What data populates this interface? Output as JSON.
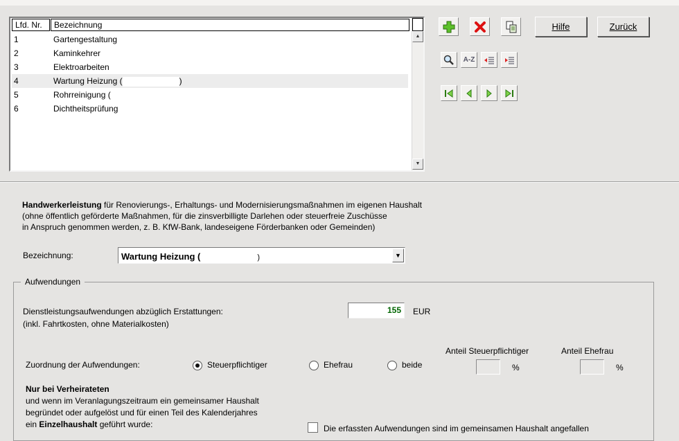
{
  "list": {
    "col_nr": "Lfd. Nr.",
    "col_bez": "Bezeichnung",
    "rows": [
      {
        "nr": "1",
        "bez": "Gartengestaltung"
      },
      {
        "nr": "2",
        "bez": "Kaminkehrer"
      },
      {
        "nr": "3",
        "bez": "Elektroarbeiten"
      },
      {
        "nr": "4",
        "bez": "Wartung Heizung ("
      },
      {
        "nr": "5",
        "bez": "Rohrreinigung ("
      },
      {
        "nr": "6",
        "bez": "Dichtheitsprüfung"
      }
    ],
    "row4_suffix": ")"
  },
  "toolbar": {
    "help_label": "Hilfe",
    "back_label": "Zurück",
    "sort_label": "A-Z",
    "icons": [
      "add-icon",
      "delete-icon",
      "copy-icon",
      "search-icon",
      "sort-az-icon",
      "indent-icon",
      "outdent-icon",
      "first-icon",
      "prev-icon",
      "next-icon",
      "last-icon"
    ]
  },
  "info": {
    "heading_bold": "Handwerkerleistung",
    "heading_rest": " für Renovierungs-, Erhaltungs- und Modernisierungsmaßnahmen im eigenen Haushalt",
    "line2": "(ohne öffentlich geförderte Maßnahmen, für die zinsverbilligte Darlehen oder steuerfreie Zuschüsse",
    "line3": "in Anspruch genommen werden, z. B. KfW-Bank, landeseigene Förderbanken oder Gemeinden)"
  },
  "form": {
    "bez_label": "Bezeichnung:",
    "bez_value": "Wartung Heizung (",
    "bez_value_end": ")",
    "group_title": "Aufwendungen",
    "dienst_label": "Dienstleistungsaufwendungen abzüglich Erstattungen:",
    "dienst_sub": "(inkl. Fahrtkosten, ohne Materialkosten)",
    "dienst_value": "155",
    "currency": "EUR",
    "anteil_stpfl": "Anteil Steuerpflichtiger",
    "anteil_ehefrau": "Anteil Ehefrau",
    "percent": "%",
    "zuordnung_label": "Zuordnung der Aufwendungen:",
    "radio_stpfl": "Steuerpflichtiger",
    "radio_ehefrau": "Ehefrau",
    "radio_beide": "beide",
    "verh_bold": "Nur bei Verheirateten",
    "verh_line2": "und wenn im Veranlagungszeitraum ein gemeinsamer Haushalt",
    "verh_line3": "begründet oder aufgelöst und für einen Teil des Kalenderjahres",
    "verh_line4_pre": "ein ",
    "verh_line4_bold": "Einzelhaushalt",
    "verh_line4_post": " geführt wurde:",
    "checkbox_label": "Die erfassten Aufwendungen sind im gemeinsamen Haushalt angefallen"
  }
}
